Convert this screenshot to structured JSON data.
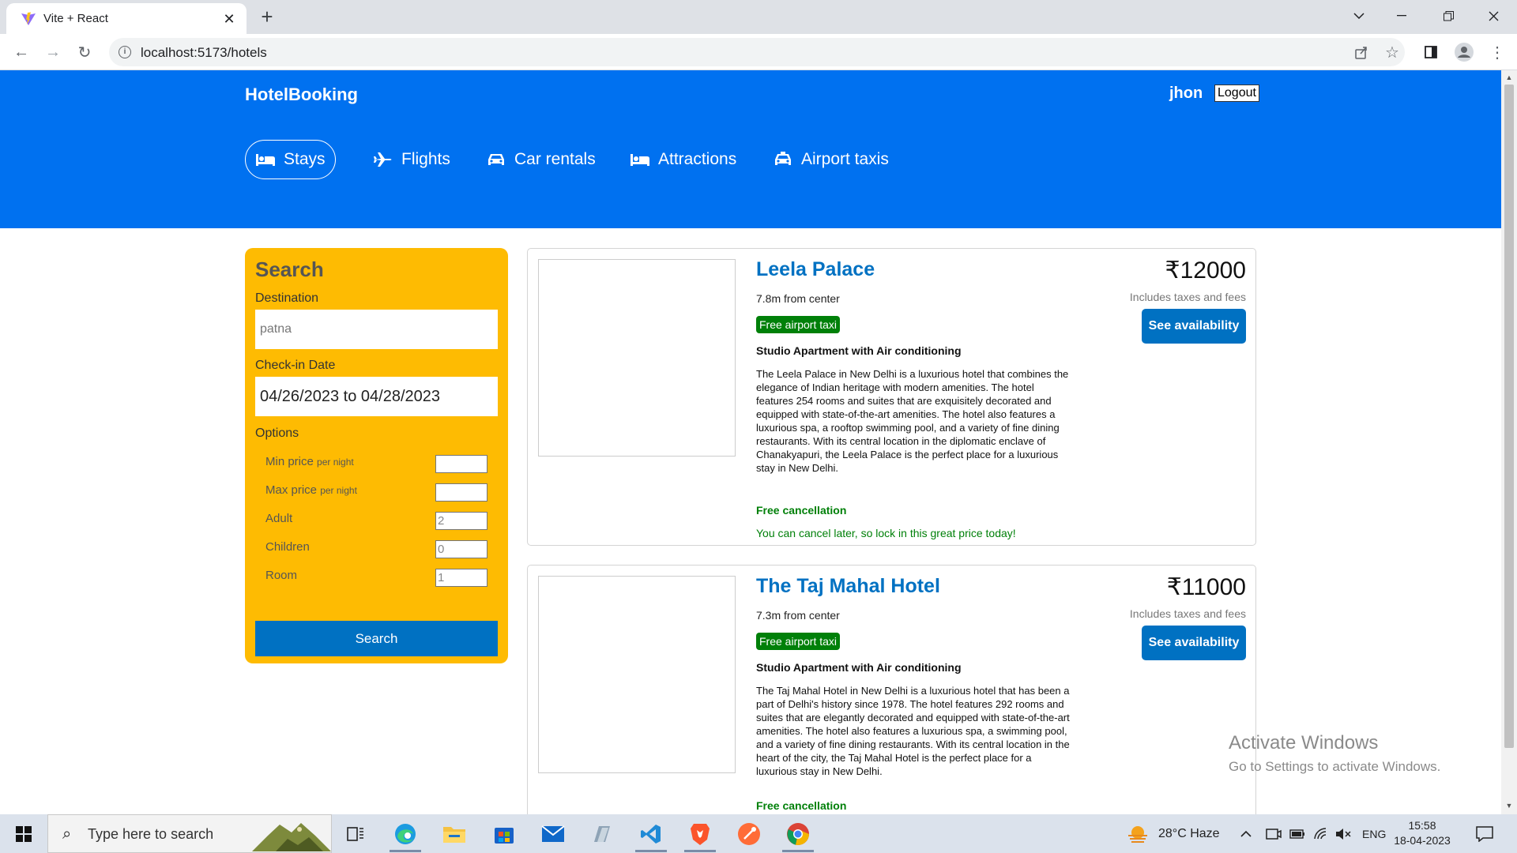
{
  "browser": {
    "tab_title": "Vite + React",
    "tab_close": "✕",
    "new_tab": "+",
    "url": "localhost:5173/hotels",
    "back": "←",
    "forward": "→",
    "reload": "↻"
  },
  "header": {
    "brand": "HotelBooking",
    "username": "jhon",
    "logout_label": "Logout",
    "nav": [
      {
        "label": "Stays",
        "icon": "bed-icon",
        "active": true
      },
      {
        "label": "Flights",
        "icon": "plane-icon"
      },
      {
        "label": "Car rentals",
        "icon": "car-icon"
      },
      {
        "label": "Attractions",
        "icon": "bed-icon"
      },
      {
        "label": "Airport taxis",
        "icon": "taxi-icon"
      }
    ]
  },
  "search": {
    "title": "Search",
    "destination_label": "Destination",
    "destination_placeholder": "patna",
    "checkin_label": "Check-in Date",
    "checkin_value": "04/26/2023 to 04/28/2023",
    "options_label": "Options",
    "per_night": "per night",
    "options": [
      {
        "label": "Min price",
        "value": ""
      },
      {
        "label": "Max price",
        "value": ""
      },
      {
        "label": "Adult",
        "value": "2"
      },
      {
        "label": "Children",
        "value": "0"
      },
      {
        "label": "Room",
        "value": "1"
      }
    ],
    "button_label": "Search"
  },
  "results": [
    {
      "name": "Leela Palace",
      "distance": "7.8m from center",
      "taxi_badge": "Free airport taxi",
      "subtitle": "Studio Apartment with Air conditioning",
      "description": "The Leela Palace in New Delhi is a luxurious hotel that combines the elegance of Indian heritage with modern amenities. The hotel features 254 rooms and suites that are exquisitely decorated and equipped with state-of-the-art amenities. The hotel also features a luxurious spa, a rooftop swimming pool, and a variety of fine dining restaurants. With its central location in the diplomatic enclave of Chanakyapuri, the Leela Palace is the perfect place for a luxurious stay in New Delhi.",
      "cancel_title": "Free cancellation",
      "cancel_sub": "You can cancel later, so lock in this great price today!",
      "price": "₹12000",
      "tax_note": "Includes taxes and fees",
      "button_label": "See availability"
    },
    {
      "name": "The Taj Mahal Hotel",
      "distance": "7.3m from center",
      "taxi_badge": "Free airport taxi",
      "subtitle": "Studio Apartment with Air conditioning",
      "description": "The Taj Mahal Hotel in New Delhi is a luxurious hotel that has been a part of Delhi's history since 1978. The hotel features 292 rooms and suites that are elegantly decorated and equipped with state-of-the-art amenities. The hotel also features a luxurious spa, a swimming pool, and a variety of fine dining restaurants. With its central location in the heart of the city, the Taj Mahal Hotel is the perfect place for a luxurious stay in New Delhi.",
      "cancel_title": "Free cancellation",
      "price": "₹11000",
      "tax_note": "Includes taxes and fees",
      "button_label": "See availability"
    }
  ],
  "watermark": {
    "line1": "Activate Windows",
    "line2": "Go to Settings to activate Windows."
  },
  "taskbar": {
    "search_placeholder": "Type here to search",
    "weather": "28°C  Haze",
    "language": "ENG",
    "time": "15:58",
    "date": "18-04-2023"
  }
}
